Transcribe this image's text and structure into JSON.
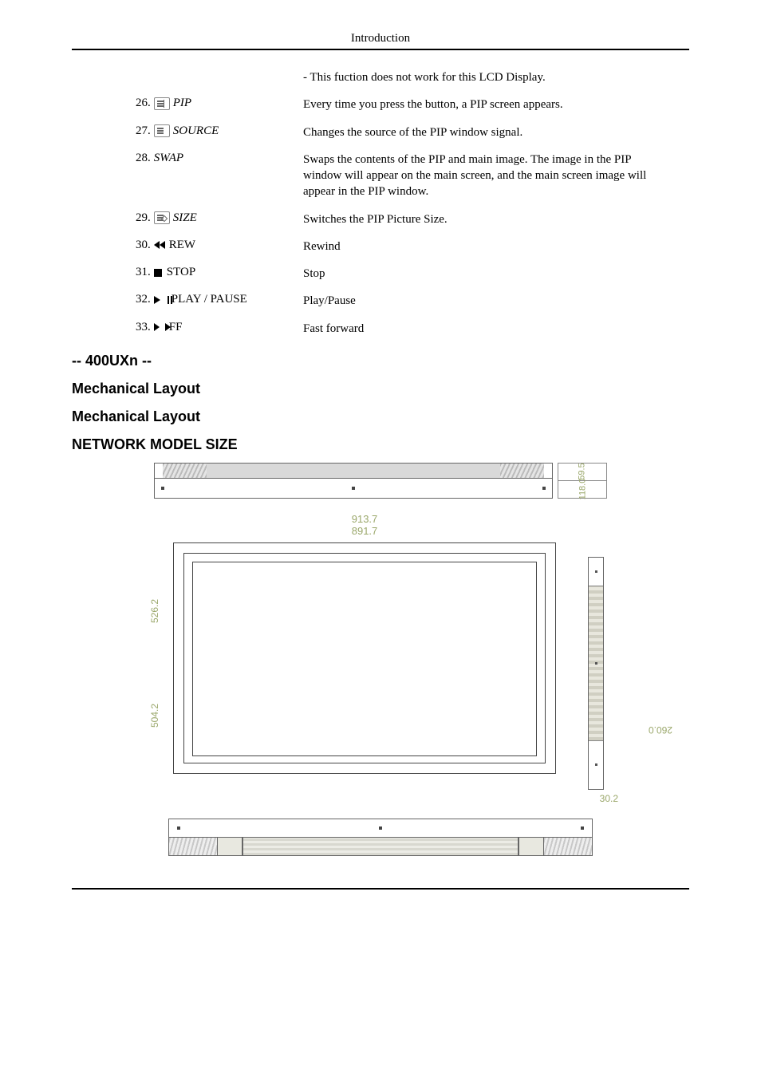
{
  "header": {
    "title": "Introduction"
  },
  "definitions": {
    "note": "- This fuction does not work for this LCD Display.",
    "rows": [
      {
        "num": "26.",
        "icon": "pip-icon",
        "label": "PIP",
        "desc": "Every time you press the button, a PIP screen appears."
      },
      {
        "num": "27.",
        "icon": "source-icon",
        "label": "SOURCE",
        "desc": "Changes the source of the PIP window signal."
      },
      {
        "num": "28.",
        "icon": "",
        "label": "SWAP",
        "desc": "Swaps the contents of the PIP and main image. The image in the PIP window will appear on the main screen, and the main screen image will appear in the PIP window."
      },
      {
        "num": "29.",
        "icon": "size-icon",
        "label": "SIZE",
        "desc": "Switches the PIP Picture Size."
      },
      {
        "num": "30.",
        "icon": "rewind-icon",
        "label": "REW",
        "desc": "Rewind"
      },
      {
        "num": "31.",
        "icon": "stop-icon",
        "label": "STOP",
        "desc": "Stop"
      },
      {
        "num": "32.",
        "icon": "playpause-icon",
        "label": "PLAY / PAUSE",
        "desc": "Play/Pause"
      },
      {
        "num": "33.",
        "icon": "ff-icon",
        "label": "FF",
        "desc": "Fast forward"
      }
    ]
  },
  "headings": {
    "model": "-- 400UXn --",
    "mech1": "Mechanical Layout",
    "mech2": "Mechanical Layout",
    "netsize": "NETWORK MODEL SIZE"
  },
  "dims": {
    "strip_h1": "59.5",
    "strip_h2": "118.0",
    "front_w_outer": "913.7",
    "front_w_inner": "891.7",
    "front_h_outer": "526.2",
    "front_h_inner": "504.2",
    "side_depth": "260.0",
    "side_foot": "30.2"
  }
}
